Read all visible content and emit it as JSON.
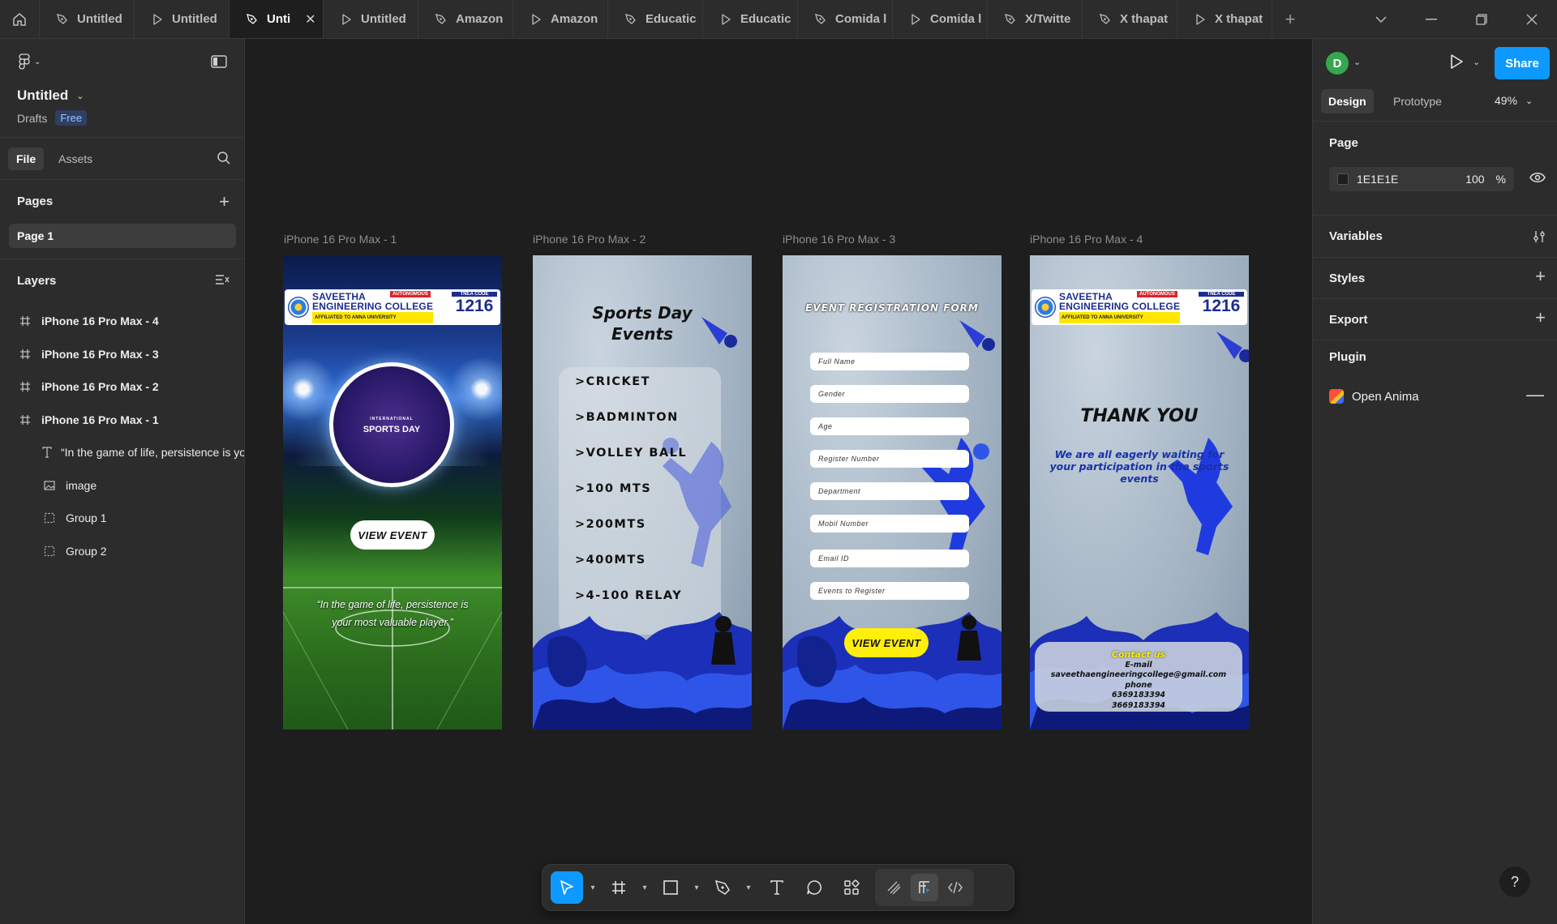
{
  "tabs": [
    {
      "label": "Untitled",
      "type": "design"
    },
    {
      "label": "Untitled",
      "type": "prototype"
    },
    {
      "label": "Unti",
      "type": "design",
      "active": true
    },
    {
      "label": "Untitled",
      "type": "prototype"
    },
    {
      "label": "Amazon",
      "type": "design"
    },
    {
      "label": "Amazon",
      "type": "prototype"
    },
    {
      "label": "Educatic",
      "type": "design"
    },
    {
      "label": "Educatic",
      "type": "prototype"
    },
    {
      "label": "Comida l",
      "type": "design"
    },
    {
      "label": "Comida l",
      "type": "prototype"
    },
    {
      "label": "X/Twitte",
      "type": "design"
    },
    {
      "label": "X thapat",
      "type": "design"
    },
    {
      "label": "X thapat",
      "type": "prototype"
    }
  ],
  "file": {
    "title": "Untitled",
    "location": "Drafts",
    "plan": "Free"
  },
  "left_tabs": {
    "file": "File",
    "assets": "Assets"
  },
  "pages": {
    "heading": "Pages",
    "items": [
      "Page 1"
    ]
  },
  "layers": {
    "heading": "Layers",
    "items": [
      {
        "label": "iPhone 16 Pro Max - 4",
        "kind": "frame"
      },
      {
        "label": "iPhone 16 Pro Max - 3",
        "kind": "frame"
      },
      {
        "label": "iPhone 16 Pro Max - 2",
        "kind": "frame"
      },
      {
        "label": "iPhone 16 Pro Max - 1",
        "kind": "frame"
      },
      {
        "label": "“In the game of life, persistence is your most valuable player.”",
        "kind": "text"
      },
      {
        "label": "image",
        "kind": "image"
      },
      {
        "label": "Group 1",
        "kind": "group"
      },
      {
        "label": "Group 2",
        "kind": "group"
      }
    ]
  },
  "frames": {
    "labels": [
      "iPhone 16 Pro Max - 1",
      "iPhone 16 Pro Max - 2",
      "iPhone 16 Pro Max - 3",
      "iPhone 16 Pro Max - 4"
    ]
  },
  "college": {
    "name_line1": "SAVEETHA",
    "name_line2": "ENGINEERING COLLEGE",
    "autonomous": "AUTONOMOUS",
    "affiliation": "AFFILIATED TO ANNA UNIVERSITY",
    "code_label": "TNEA CODE",
    "code": "1216"
  },
  "phone1": {
    "badge_small": "INTERNATIONAL",
    "badge": "SPORTS DAY",
    "button": "VIEW EVENT",
    "quote": "“In the game of life, persistence is your most valuable player.”"
  },
  "phone2": {
    "title_line1": "Sports Day",
    "title_line2": "Events",
    "events": [
      ">CRICKET",
      ">BADMINTON",
      ">VOLLEY BALL",
      ">100 MTS",
      ">200MTS",
      ">400MTS",
      ">4-100 RELAY"
    ]
  },
  "phone3": {
    "title": "EVENT REGISTRATION FORM",
    "fields": [
      "Full Name",
      "Gender",
      "Age",
      "Register Number",
      "Department",
      "Mobil Number",
      "Email ID",
      "Events to Register"
    ],
    "button": "VIEW EVENT"
  },
  "phone4": {
    "title": "THANK YOU",
    "message": "We are all eagerly waiting for your participation in the sports events",
    "contact_title": "Contact us",
    "email_label": "E-mail",
    "email": "saveethaengineeringcollege@gmail.com",
    "phone_label": "phone",
    "phones": [
      "6369183394",
      "3669183394"
    ]
  },
  "right": {
    "avatar_initial": "D",
    "share": "Share",
    "tab_design": "Design",
    "tab_prototype": "Prototype",
    "zoom": "49%",
    "page_heading": "Page",
    "page_color": "1E1E1E",
    "page_opacity": "100",
    "percent": "%",
    "variables": "Variables",
    "styles": "Styles",
    "export": "Export",
    "plugin": "Plugin",
    "plugin_name": "Open Anima"
  },
  "help": "?",
  "colors": {
    "accent": "#0d99ff",
    "canvas": "#1e1e1e",
    "panel": "#2c2c2c",
    "avatar": "#36a64f"
  }
}
